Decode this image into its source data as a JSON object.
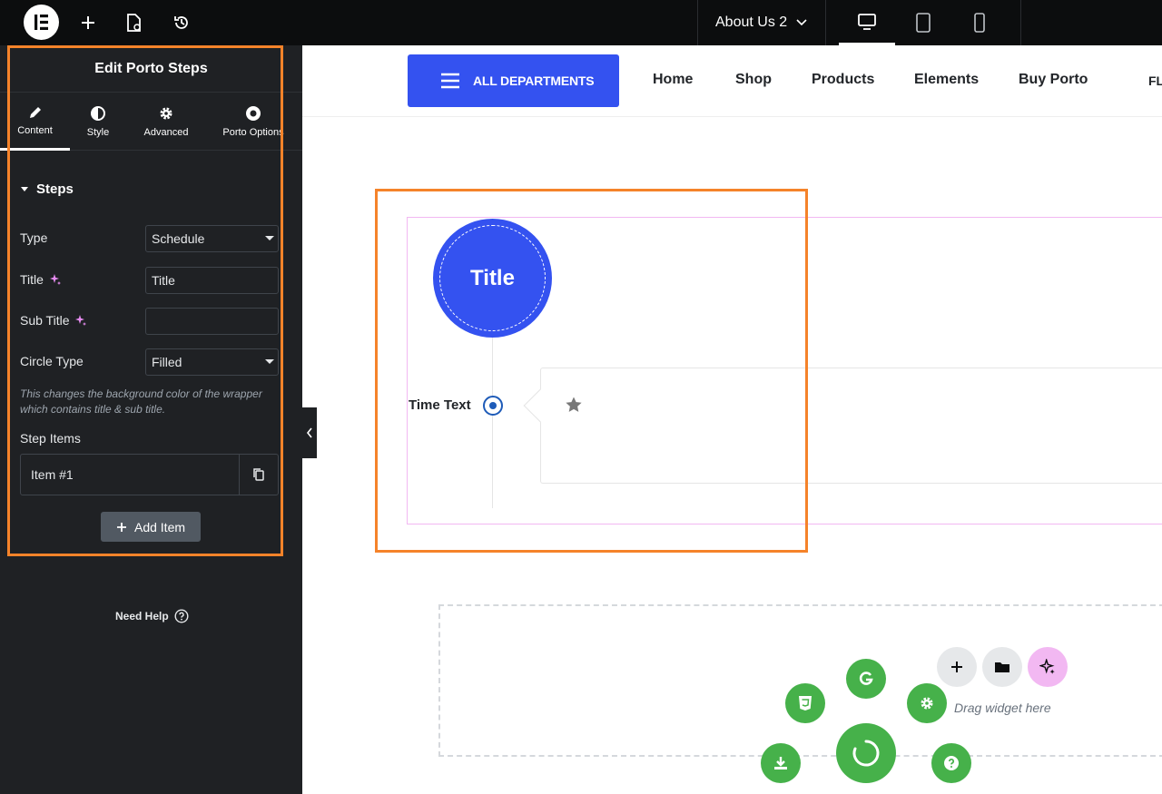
{
  "topbar": {
    "logo_icon": "elementor-logo-icon",
    "page_name": "About Us 2"
  },
  "panel": {
    "title": "Edit Porto Steps",
    "tabs": [
      {
        "label": "Content",
        "icon": "pencil-icon"
      },
      {
        "label": "Style",
        "icon": "half-circle-icon"
      },
      {
        "label": "Advanced",
        "icon": "gear-icon"
      },
      {
        "label": "Porto Options",
        "icon": "porto-options-icon"
      }
    ],
    "section": "Steps",
    "fields": {
      "type_label": "Type",
      "type_value": "Schedule",
      "title_label": "Title",
      "title_value": "Title",
      "subtitle_label": "Sub Title",
      "subtitle_value": "",
      "circle_type_label": "Circle Type",
      "circle_type_value": "Filled"
    },
    "help_text": "This changes the background color of the wrapper which contains title & sub title.",
    "step_items_label": "Step Items",
    "items": [
      {
        "title": "Item #1"
      }
    ],
    "add_item_label": "Add Item",
    "need_help_label": "Need Help"
  },
  "site": {
    "departments_label": "ALL DEPARTMENTS",
    "nav": [
      "Home",
      "Shop",
      "Products",
      "Elements",
      "Buy Porto",
      "FL"
    ]
  },
  "widget": {
    "circle_title": "Title",
    "time_text": "Time Text"
  },
  "dropzone": {
    "drag_text": "Drag widget here"
  },
  "colors": {
    "accent_blue": "#3452f0",
    "highlight_orange": "#f5832a",
    "fab_green": "#46b14a",
    "panel_bg": "#1f2124"
  }
}
